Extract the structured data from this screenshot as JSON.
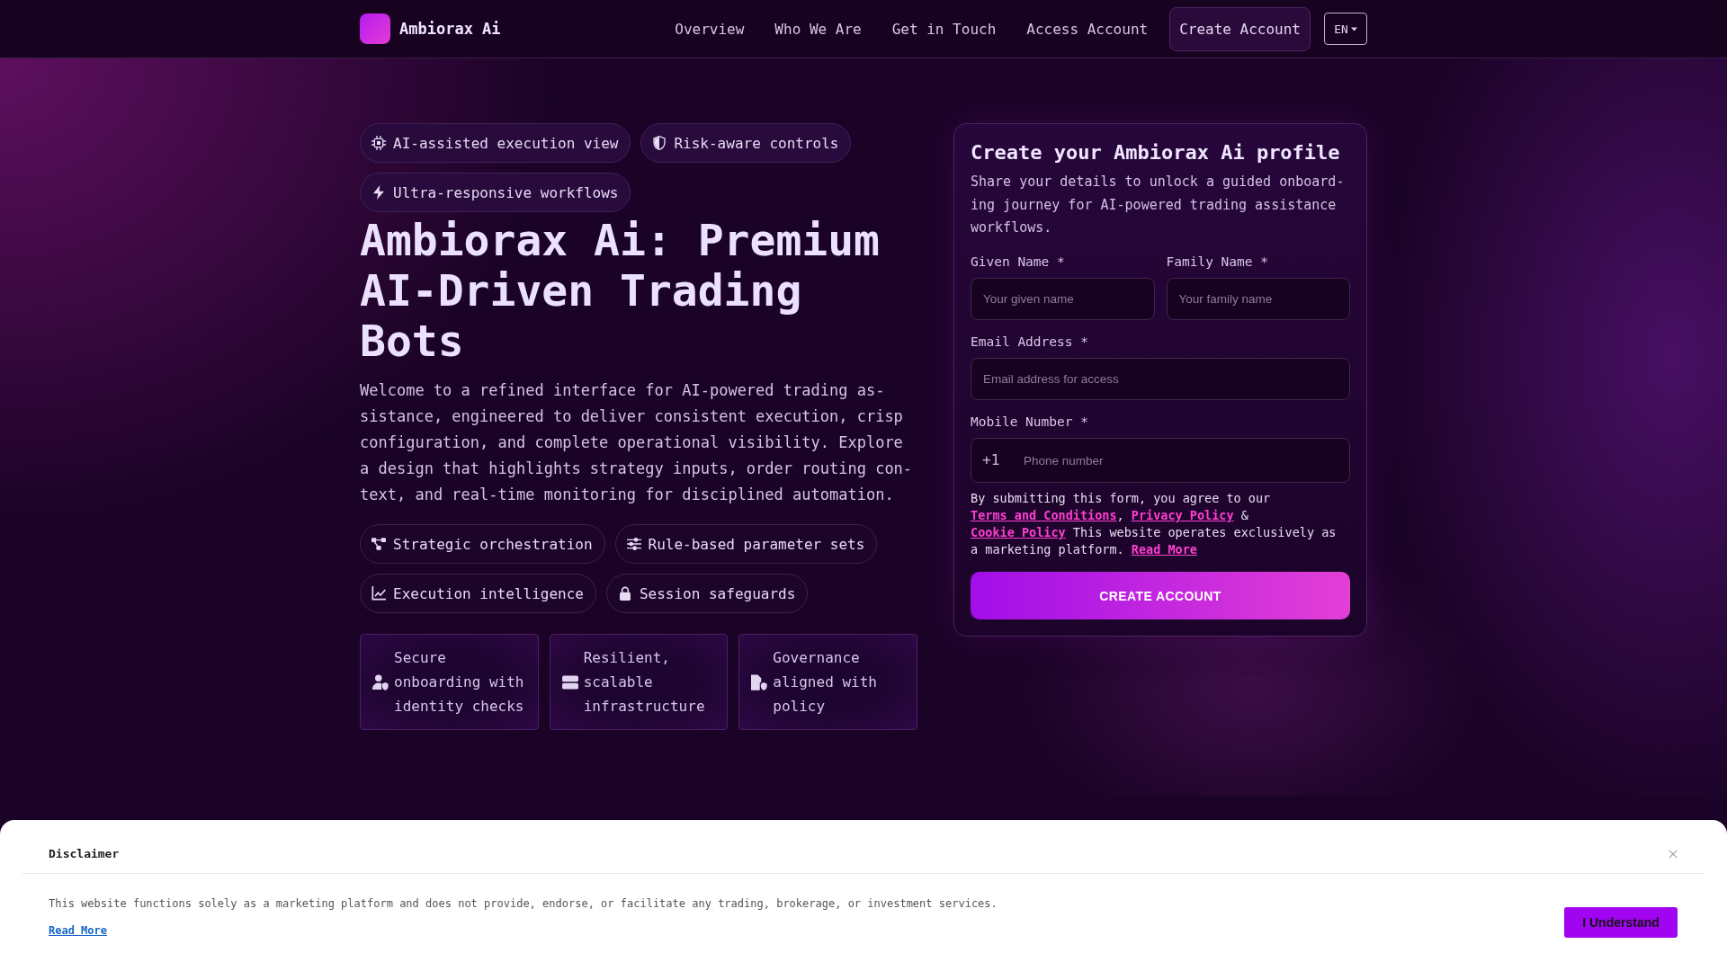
{
  "header": {
    "brand": "Ambiorax Ai",
    "nav": [
      {
        "label": "Overview",
        "kind": "link"
      },
      {
        "label": "Who We Are",
        "kind": "link"
      },
      {
        "label": "Get in Touch",
        "kind": "link"
      },
      {
        "label": "Access Account",
        "kind": "link"
      },
      {
        "label": "Create Account",
        "kind": "button"
      }
    ],
    "language": "EN"
  },
  "hero": {
    "highlights": [
      "AI-assisted execution view",
      "Risk-aware controls",
      "Ultra-responsive workflows"
    ],
    "title": "Ambiorax Ai: Premium AI-Driven Trading Bots",
    "description": "Welcome to a refined interface for AI-powered trading as-sistance, engineered to deliver consistent execution, crisp configuration, and complete operational visibility. Explore a design that highlights strategy inputs, order routing con-text, and real-time monitoring for disciplined automation.",
    "features": [
      "Strategic orchestration",
      "Rule-based parameter sets",
      "Execution intelligence",
      "Session safeguards"
    ],
    "cards": [
      "Secure onboarding with identity checks",
      "Resilient, scalable infrastructure",
      "Governance aligned with policy"
    ]
  },
  "signup_form": {
    "title": "Create your Ambiorax Ai profile",
    "description": "Share your details to unlock a guided onboard-ing journey for AI-powered trading assistance workflows.",
    "rows": [
      [
        {
          "label": "Given Name *",
          "placeholder": "Your given name",
          "kind": "text"
        },
        {
          "label": "Family Name *",
          "placeholder": "Your family name",
          "kind": "text"
        }
      ],
      [
        {
          "label": "Email Address *",
          "placeholder": "Email address for access",
          "kind": "email"
        }
      ],
      [
        {
          "label": "Mobile Number *",
          "placeholder": "Phone number",
          "kind": "phone",
          "country_code": "+1"
        }
      ]
    ],
    "consent": [
      {
        "kind": "text",
        "text": "By submitting this form, you agree to our "
      },
      {
        "kind": "link",
        "text": "Terms and Conditions"
      },
      {
        "kind": "text",
        "text": ", "
      },
      {
        "kind": "link",
        "text": "Privacy Policy"
      },
      {
        "kind": "text",
        "text": " & "
      },
      {
        "kind": "link",
        "text": "Cookie Policy"
      },
      {
        "kind": "text",
        "text": " This website operates exclusively as a marketing platform. "
      },
      {
        "kind": "link",
        "text": "Read More"
      }
    ],
    "submit": "CREATE ACCOUNT"
  },
  "disclaimer": {
    "title": "Disclaimer",
    "text": "This website functions solely as a marketing platform and does not provide, endorse, or facilitate any trading, brokerage, or investment services.",
    "link": "Read More",
    "button": "I Understand"
  }
}
